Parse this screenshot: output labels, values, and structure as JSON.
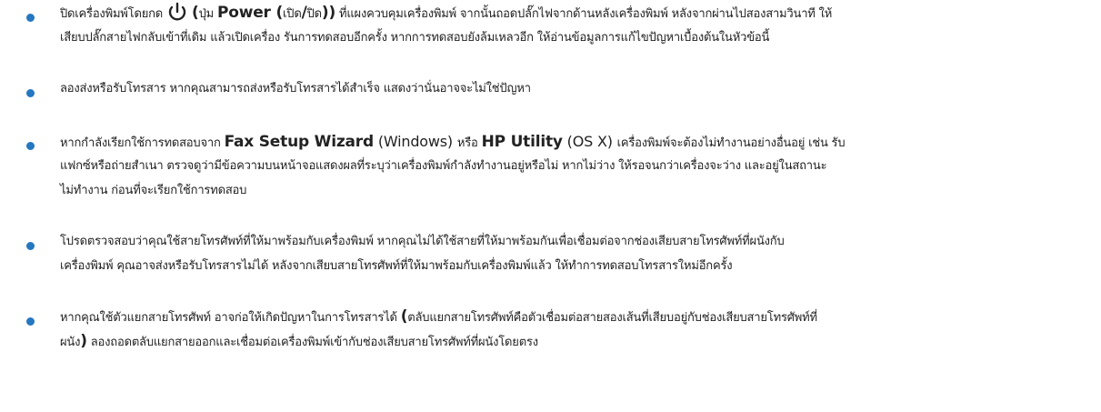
{
  "items": [
    {
      "lines": [
        {
          "pre": "ปิดเครื่องพิมพ์โดยกด",
          "paren_open": "(",
          "mid1": "ปุ่ม ",
          "power_label": "Power",
          "paren2_open": " (",
          "mid2": "เปิด",
          "slash": "/",
          "mid3": "ปิด",
          "paren_close": "))",
          "post": " ที่แผงควบคุมเครื่องพิมพ์ จากนั้นถอดปลั๊กไฟจากด้านหลังเครื่องพิมพ์ หลังจากผ่านไปสองสามวินาที ให้"
        },
        "เสียบปลั๊กสายไฟกลับเข้าที่เดิม แล้วเปิดเครื่อง รันการทดสอบอีกครั้ง หากการทดสอบยังล้มเหลวอีก ให้อ่านข้อมูลการแก้ไขปัญหาเบื้องต้นในหัวข้อนี้"
      ]
    },
    {
      "lines": [
        "ลองส่งหรือรับโทรสาร หากคุณสามารถส่งหรือรับโทรสารได้สำเร็จ แสดงว่านั่นอาจจะไม่ใช่ปัญหา"
      ]
    },
    {
      "lines": [
        {
          "pre": "หากกำลังเรียกใช้การทดสอบจาก ",
          "ui1": "Fax Setup Wizard",
          "os1": " (Windows) ",
          "mid": "หรือ ",
          "ui2": "HP Utility",
          "os2": " (OS X) ",
          "post": "เครื่องพิมพ์จะต้องไม่ทำงานอย่างอื่นอยู่ เช่น รับ"
        },
        "แฟกซ์หรือถ่ายสำเนา ตรวจดูว่ามีข้อความบนหน้าจอแสดงผลที่ระบุว่าเครื่องพิมพ์กำลังทำงานอยู่หรือไม่ หากไม่ว่าง ให้รอจนกว่าเครื่องจะว่าง และอยู่ในสถานะ",
        "ไม่ทำงาน ก่อนที่จะเรียกใช้การทดสอบ"
      ]
    },
    {
      "lines": [
        "โปรดตรวจสอบว่าคุณใช้สายโทรศัพท์ที่ให้มาพร้อมกับเครื่องพิมพ์ หากคุณไม่ได้ใช้สายที่ให้มาพร้อมกันเพื่อเชื่อมต่อจากช่องเสียบสายโทรศัพท์ที่ผนังกับ",
        "เครื่องพิมพ์ คุณอาจส่งหรือรับโทรสารไม่ได้ หลังจากเสียบสายโทรศัพท์ที่ให้มาพร้อมกับเครื่องพิมพ์แล้ว ให้ทำการทดสอบโทรสารใหม่อีกครั้ง"
      ]
    },
    {
      "lines": [
        {
          "pre": "หากคุณใช้ตัวแยกสายโทรศัพท์ อาจก่อให้เกิดปัญหาในการโทรสารได้ ",
          "paren_open": "(",
          "post": "ตลับแยกสายโทรศัพท์คือตัวเชื่อมต่อสายสองเส้นที่เสียบอยู่กับช่องเสียบสายโทรศัพท์ที่"
        },
        {
          "pre": "ผนัง",
          "paren_close": ")",
          "post": " ลองถอดตลับแยกสายออกและเชื่อมต่อเครื่องพิมพ์เข้ากับช่องเสียบสายโทรศัพท์ที่ผนังโดยตรง"
        }
      ]
    }
  ],
  "colors": {
    "bullet": "#2577c1",
    "text": "#222222"
  },
  "icons": {
    "power": "power-icon"
  }
}
